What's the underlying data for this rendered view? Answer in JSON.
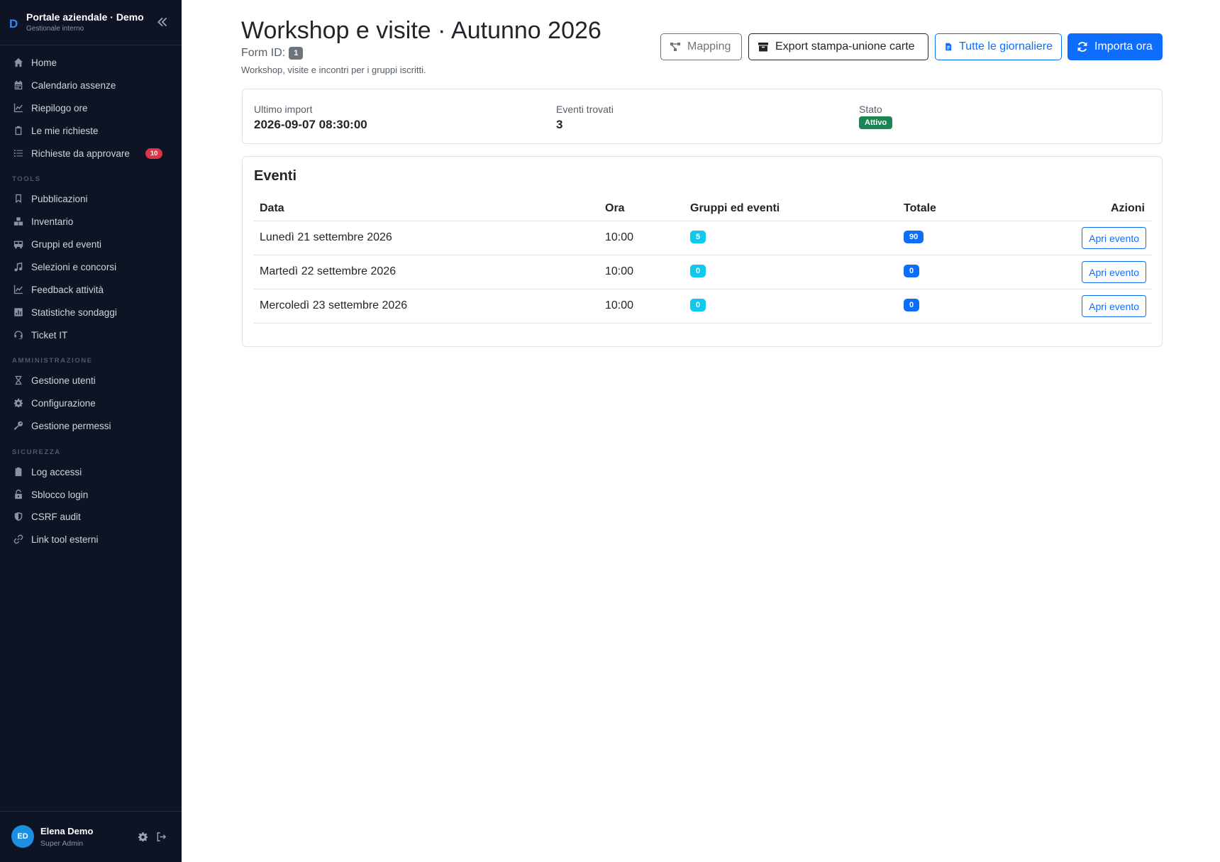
{
  "brand": {
    "logo": "D",
    "title": "Portale aziendale · Demo",
    "subtitle": "Gestionale interno"
  },
  "sidebar": {
    "main": [
      {
        "label": "Home",
        "icon": "home-icon"
      },
      {
        "label": "Calendario assenze",
        "icon": "calendar-icon"
      },
      {
        "label": "Riepilogo ore",
        "icon": "chart-line-icon"
      },
      {
        "label": "Le mie richieste",
        "icon": "clipboard-icon"
      },
      {
        "label": "Richieste da approvare",
        "icon": "list-check-icon",
        "badge": "10"
      }
    ],
    "tools_title": "TOOLS",
    "tools": [
      {
        "label": "Pubblicazioni",
        "icon": "bookmark-icon"
      },
      {
        "label": "Inventario",
        "icon": "boxes-icon"
      },
      {
        "label": "Gruppi ed eventi",
        "icon": "bus-icon"
      },
      {
        "label": "Selezioni e concorsi",
        "icon": "music-icon"
      },
      {
        "label": "Feedback attività",
        "icon": "chart-line-icon"
      },
      {
        "label": "Statistiche sondaggi",
        "icon": "poll-icon"
      },
      {
        "label": "Ticket IT",
        "icon": "headset-icon"
      }
    ],
    "admin_title": "AMMINISTRAZIONE",
    "admin": [
      {
        "label": "Gestione utenti",
        "icon": "hourglass-icon"
      },
      {
        "label": "Configurazione",
        "icon": "gear-icon"
      },
      {
        "label": "Gestione permessi",
        "icon": "key-icon"
      }
    ],
    "security_title": "SICUREZZA",
    "security": [
      {
        "label": "Log accessi",
        "icon": "clipboard-icon"
      },
      {
        "label": "Sblocco login",
        "icon": "unlock-icon"
      },
      {
        "label": "CSRF audit",
        "icon": "shield-icon"
      },
      {
        "label": "Link tool esterni",
        "icon": "link-icon"
      }
    ]
  },
  "user": {
    "initials": "ED",
    "name": "Elena Demo",
    "role": "Super Admin"
  },
  "header": {
    "title": "Workshop e visite · Autunno 2026",
    "form_id_label": "Form ID:",
    "form_id": "1",
    "description": "Workshop, visite e incontri per i gruppi iscritti.",
    "buttons": {
      "mapping": "Mapping",
      "export": "Export stampa-unione carte",
      "tutte": "Tutte le giornaliere",
      "importa": "Importa ora"
    }
  },
  "summary": {
    "last_import_label": "Ultimo import",
    "last_import": "2026-09-07 08:30:00",
    "events_found_label": "Eventi trovati",
    "events_found": "3",
    "status_label": "Stato",
    "status": "Attivo"
  },
  "events": {
    "title": "Eventi",
    "columns": [
      "Data",
      "Ora",
      "Gruppi ed eventi",
      "Totale",
      "Azioni"
    ],
    "rows": [
      {
        "date": "Lunedì 21 settembre 2026",
        "time": "10:00",
        "groups": "5",
        "total": "90",
        "action": "Apri evento"
      },
      {
        "date": "Martedì 22 settembre 2026",
        "time": "10:00",
        "groups": "0",
        "total": "0",
        "action": "Apri evento"
      },
      {
        "date": "Mercoledì 23 settembre 2026",
        "time": "10:00",
        "groups": "0",
        "total": "0",
        "action": "Apri evento"
      }
    ]
  },
  "colors": {
    "sidebar_bg": "#0e1424",
    "primary": "#0d6efd",
    "info": "#0dcaf0",
    "success": "#198754",
    "danger": "#dc3545"
  }
}
